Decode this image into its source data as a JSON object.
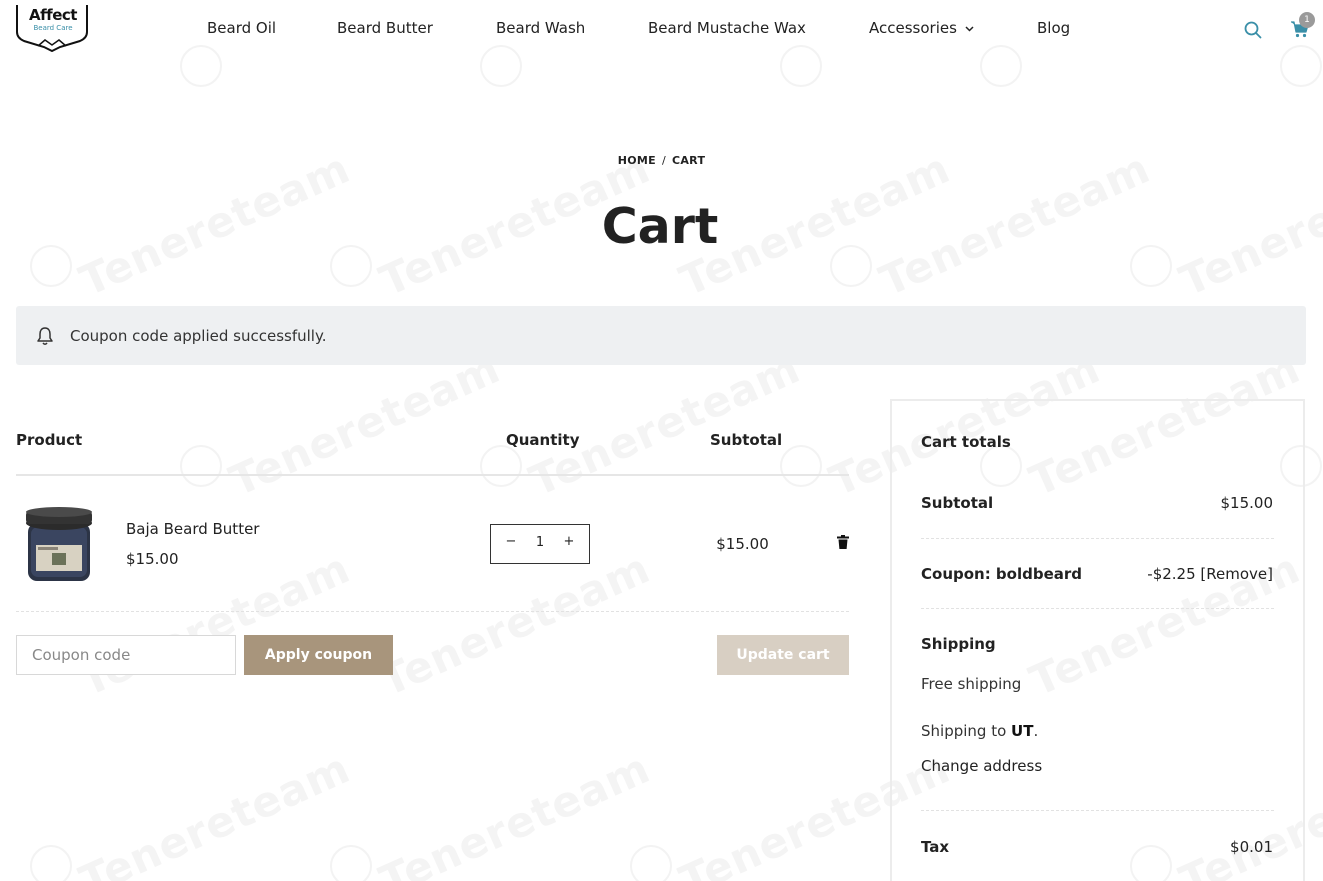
{
  "header": {
    "logo_name": "Affect",
    "logo_tagline": "Beard Care",
    "nav": [
      {
        "label": "Beard Oil"
      },
      {
        "label": "Beard Butter"
      },
      {
        "label": "Beard Wash"
      },
      {
        "label": "Beard Mustache Wax"
      },
      {
        "label": "Accessories",
        "has_dropdown": true
      },
      {
        "label": "Blog"
      }
    ],
    "cart_count": "1",
    "icons": [
      "search-icon",
      "cart-icon",
      "chevron-down-icon"
    ]
  },
  "breadcrumb": {
    "home": "HOME",
    "separator": "/",
    "current": "CART"
  },
  "page_title": "Cart",
  "notice": {
    "text": "Coupon code applied successfully.",
    "icon": "bell-icon"
  },
  "cart_table": {
    "headers": {
      "product": "Product",
      "quantity": "Quantity",
      "subtotal": "Subtotal"
    },
    "items": [
      {
        "name": "Baja Beard Butter",
        "price": "$15.00",
        "quantity": "1",
        "subtotal": "$15.00"
      }
    ],
    "qty_minus": "−",
    "qty_plus": "+"
  },
  "coupon": {
    "placeholder": "Coupon code",
    "apply_label": "Apply coupon"
  },
  "update_label": "Update cart",
  "totals": {
    "title": "Cart totals",
    "subtotal_label": "Subtotal",
    "subtotal_value": "$15.00",
    "coupon_label": "Coupon: boldbeard",
    "coupon_value": "-$2.25",
    "coupon_remove": "[Remove]",
    "shipping_label": "Shipping",
    "shipping_method": "Free shipping",
    "shipping_to_prefix": "Shipping to ",
    "shipping_to_state": "UT",
    "shipping_to_suffix": ".",
    "change_address": "Change address",
    "tax_label": "Tax",
    "tax_value": "$0.01"
  },
  "colors": {
    "accent": "#a8957c",
    "update_disabled": "#d8cfc3",
    "notice_bg": "#eef0f2",
    "search_icon": "#3a8fa8"
  },
  "watermark": "Tenereteam"
}
